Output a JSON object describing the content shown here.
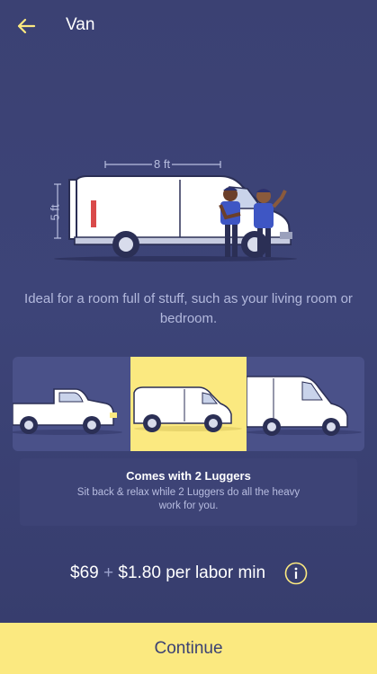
{
  "header": {
    "title": "Van",
    "back_icon": "arrow-left-icon"
  },
  "hero": {
    "width_label": "8 ft",
    "height_label": "5 ft"
  },
  "description": "Ideal for a room full of stuff, such as your living room or bedroom.",
  "vehicles": [
    {
      "name": "pickup-truck",
      "selected": false
    },
    {
      "name": "cargo-van",
      "selected": true
    },
    {
      "name": "box-van",
      "selected": false
    }
  ],
  "luggers": {
    "title": "Comes with 2 Luggers",
    "subtitle": "Sit back & relax while 2 Luggers do all the heavy work for you."
  },
  "pricing": {
    "base": "$69",
    "plus": "+",
    "rate": "$1.80 per labor min",
    "info_icon": "info-icon"
  },
  "cta": {
    "label": "Continue"
  },
  "colors": {
    "background": "#3b4173",
    "accent": "#fbe980",
    "muted_text": "#b3b9dd"
  }
}
